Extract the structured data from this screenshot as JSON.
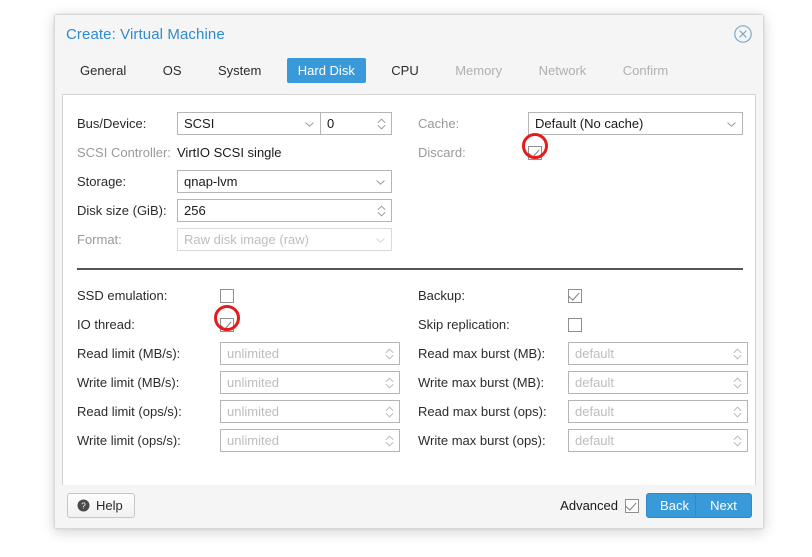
{
  "dialog": {
    "title": "Create: Virtual Machine",
    "close_icon": "close-circle-icon"
  },
  "tabs": [
    {
      "label": "General",
      "state": "normal"
    },
    {
      "label": "OS",
      "state": "normal"
    },
    {
      "label": "System",
      "state": "normal"
    },
    {
      "label": "Hard Disk",
      "state": "active"
    },
    {
      "label": "CPU",
      "state": "normal"
    },
    {
      "label": "Memory",
      "state": "disabled"
    },
    {
      "label": "Network",
      "state": "disabled"
    },
    {
      "label": "Confirm",
      "state": "disabled"
    }
  ],
  "form": {
    "left_top": {
      "bus_device": {
        "label": "Bus/Device:",
        "bus_value": "SCSI",
        "device_value": "0"
      },
      "scsi_controller": {
        "label": "SCSI Controller:",
        "value": "VirtIO SCSI single"
      },
      "storage": {
        "label": "Storage:",
        "value": "qnap-lvm"
      },
      "disk_size": {
        "label": "Disk size (GiB):",
        "value": "256"
      },
      "format": {
        "label": "Format:",
        "value": "Raw disk image (raw)",
        "disabled": true
      }
    },
    "right_top": {
      "cache": {
        "label": "Cache:",
        "value": "Default (No cache)"
      },
      "discard": {
        "label": "Discard:",
        "checked": true,
        "highlighted": true
      }
    },
    "left_bottom": [
      {
        "label": "SSD emulation:",
        "type": "checkbox",
        "checked": false,
        "highlighted": false
      },
      {
        "label": "IO thread:",
        "type": "checkbox",
        "checked": true,
        "highlighted": true
      },
      {
        "label": "Read limit (MB/s):",
        "type": "spinner",
        "placeholder": "unlimited"
      },
      {
        "label": "Write limit (MB/s):",
        "type": "spinner",
        "placeholder": "unlimited"
      },
      {
        "label": "Read limit (ops/s):",
        "type": "spinner",
        "placeholder": "unlimited"
      },
      {
        "label": "Write limit (ops/s):",
        "type": "spinner",
        "placeholder": "unlimited"
      }
    ],
    "right_bottom": [
      {
        "label": "Backup:",
        "type": "checkbox",
        "checked": true,
        "highlighted": false
      },
      {
        "label": "Skip replication:",
        "type": "checkbox",
        "checked": false,
        "highlighted": false
      },
      {
        "label": "Read max burst (MB):",
        "type": "spinner",
        "placeholder": "default"
      },
      {
        "label": "Write max burst (MB):",
        "type": "spinner",
        "placeholder": "default"
      },
      {
        "label": "Read max burst (ops):",
        "type": "spinner",
        "placeholder": "default"
      },
      {
        "label": "Write max burst (ops):",
        "type": "spinner",
        "placeholder": "default"
      }
    ]
  },
  "footer": {
    "help_label": "Help",
    "help_icon": "question-circle-icon",
    "advanced_label": "Advanced",
    "advanced_checked": true,
    "back_label": "Back",
    "next_label": "Next"
  },
  "colors": {
    "accent": "#3a9ad9",
    "title": "#2f8ccc",
    "annotation": "#e51b1b",
    "panel": "#f5f5f5"
  }
}
